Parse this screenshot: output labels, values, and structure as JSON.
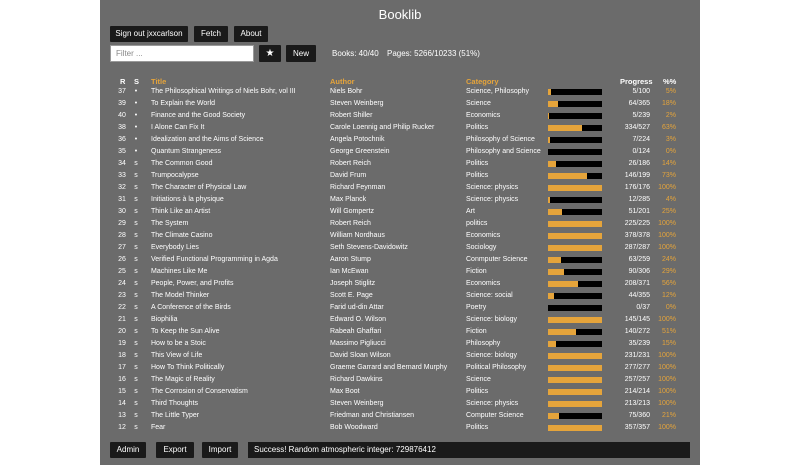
{
  "app": {
    "title": "Booklib",
    "signout_label": "Sign out jxxcarlson",
    "fetch_label": "Fetch",
    "about_label": "About",
    "filter_placeholder": "Filter ...",
    "star_label": "★",
    "new_label": "New",
    "books_stat": "Books: 40/40",
    "pages_stat": "Pages: 5266/10233 (51%)"
  },
  "table": {
    "headers": {
      "r": "R",
      "s": "S",
      "title": "Title",
      "author": "Author",
      "category": "Category",
      "progress": "Progress",
      "pct": "%%"
    },
    "rows": [
      {
        "r": "37",
        "s": "•",
        "title": "The Philosophical Writings of Niels Bohr, vol III",
        "author": "Niels Bohr",
        "category": "Science, Philosophy",
        "progress": "5/100",
        "pct": "5%",
        "fraction": 0.05
      },
      {
        "r": "39",
        "s": "•",
        "title": "To Explain the World",
        "author": "Steven Weinberg",
        "category": "Science",
        "progress": "64/365",
        "pct": "18%",
        "fraction": 0.18
      },
      {
        "r": "40",
        "s": "•",
        "title": "Finance and the Good Society",
        "author": "Robert Shiller",
        "category": "Economics",
        "progress": "5/239",
        "pct": "2%",
        "fraction": 0.02
      },
      {
        "r": "38",
        "s": "•",
        "title": "I Alone Can Fix It",
        "author": "Carole Loennig and Philip Rucker",
        "category": "Politics",
        "progress": "334/527",
        "pct": "63%",
        "fraction": 0.63
      },
      {
        "r": "36",
        "s": "•",
        "title": "Idealization and the Aims of Science",
        "author": "Angela Potochnik",
        "category": "Philosophy of Science",
        "progress": "7/224",
        "pct": "3%",
        "fraction": 0.03
      },
      {
        "r": "35",
        "s": "•",
        "title": "Quantum Strangeness",
        "author": "George Greenstein",
        "category": "Philosophy and Science",
        "progress": "0/124",
        "pct": "0%",
        "fraction": 0
      },
      {
        "r": "34",
        "s": "s",
        "title": "The Common Good",
        "author": "Robert Reich",
        "category": "Politics",
        "progress": "26/186",
        "pct": "14%",
        "fraction": 0.14
      },
      {
        "r": "33",
        "s": "s",
        "title": "Trumpocalypse",
        "author": "David Frum",
        "category": "Politics",
        "progress": "146/199",
        "pct": "73%",
        "fraction": 0.73
      },
      {
        "r": "32",
        "s": "s",
        "title": "The Character of Physical Law",
        "author": "Richard Feynman",
        "category": "Science: physics",
        "progress": "176/176",
        "pct": "100%",
        "fraction": 1
      },
      {
        "r": "31",
        "s": "s",
        "title": "Initiations à la physique",
        "author": "Max Planck",
        "category": "Science: physics",
        "progress": "12/285",
        "pct": "4%",
        "fraction": 0.04
      },
      {
        "r": "30",
        "s": "s",
        "title": "Think Like an Artist",
        "author": "Will Gompertz",
        "category": "Art",
        "progress": "51/201",
        "pct": "25%",
        "fraction": 0.25
      },
      {
        "r": "29",
        "s": "s",
        "title": "The System",
        "author": "Robert Reich",
        "category": "politics",
        "progress": "225/225",
        "pct": "100%",
        "fraction": 1
      },
      {
        "r": "28",
        "s": "s",
        "title": "The Climate Casino",
        "author": "William Nordhaus",
        "category": "Economics",
        "progress": "378/378",
        "pct": "100%",
        "fraction": 1
      },
      {
        "r": "27",
        "s": "s",
        "title": "Everybody Lies",
        "author": "Seth Stevens-Davidowitz",
        "category": "Sociology",
        "progress": "287/287",
        "pct": "100%",
        "fraction": 1
      },
      {
        "r": "26",
        "s": "s",
        "title": "Verified Functional Programming in Agda",
        "author": "Aaron Stump",
        "category": "Conmputer Science",
        "progress": "63/259",
        "pct": "24%",
        "fraction": 0.24
      },
      {
        "r": "25",
        "s": "s",
        "title": "Machines Like Me",
        "author": "Ian McEwan",
        "category": "Fiction",
        "progress": "90/306",
        "pct": "29%",
        "fraction": 0.29
      },
      {
        "r": "24",
        "s": "s",
        "title": "People, Power, and Profits",
        "author": "Joseph Stiglitz",
        "category": "Economics",
        "progress": "208/371",
        "pct": "56%",
        "fraction": 0.56
      },
      {
        "r": "23",
        "s": "s",
        "title": "The Model Thinker",
        "author": "Scott E. Page",
        "category": "Science: social",
        "progress": "44/355",
        "pct": "12%",
        "fraction": 0.12
      },
      {
        "r": "22",
        "s": "s",
        "title": "A Conference of the Birds",
        "author": "Farid ud-din Attar",
        "category": "Poetry",
        "progress": "0/37",
        "pct": "0%",
        "fraction": 0
      },
      {
        "r": "21",
        "s": "s",
        "title": "Biophilia",
        "author": "Edward O. Wilson",
        "category": "Science: biology",
        "progress": "145/145",
        "pct": "100%",
        "fraction": 1
      },
      {
        "r": "20",
        "s": "s",
        "title": "To Keep the Sun Alive",
        "author": "Rabeah Ghaffari",
        "category": "Fiction",
        "progress": "140/272",
        "pct": "51%",
        "fraction": 0.51
      },
      {
        "r": "19",
        "s": "s",
        "title": "How to be a Stoic",
        "author": "Massimo Pigliucci",
        "category": "Philosophy",
        "progress": "35/239",
        "pct": "15%",
        "fraction": 0.15
      },
      {
        "r": "18",
        "s": "s",
        "title": "This View of Life",
        "author": "David Sloan Wilson",
        "category": "Science: biology",
        "progress": "231/231",
        "pct": "100%",
        "fraction": 1
      },
      {
        "r": "17",
        "s": "s",
        "title": "How To Think Politically",
        "author": "Graeme Garrard and Bernard Murphy",
        "category": "Political Philosophy",
        "progress": "277/277",
        "pct": "100%",
        "fraction": 1
      },
      {
        "r": "16",
        "s": "s",
        "title": "The Magic of Reality",
        "author": "Richard Dawkins",
        "category": "Science",
        "progress": "257/257",
        "pct": "100%",
        "fraction": 1
      },
      {
        "r": "15",
        "s": "s",
        "title": "The Corrosion of Conservatism",
        "author": "Max Boot",
        "category": "Politics",
        "progress": "214/214",
        "pct": "100%",
        "fraction": 1
      },
      {
        "r": "14",
        "s": "s",
        "title": "Third Thoughts",
        "author": "Steven Weinberg",
        "category": "Science: physics",
        "progress": "213/213",
        "pct": "100%",
        "fraction": 1
      },
      {
        "r": "13",
        "s": "s",
        "title": "The Little Typer",
        "author": "Friedman and Christiansen",
        "category": "Computer Science",
        "progress": "75/360",
        "pct": "21%",
        "fraction": 0.21
      },
      {
        "r": "12",
        "s": "s",
        "title": "Fear",
        "author": "Bob Woodward",
        "category": "Politics",
        "progress": "357/357",
        "pct": "100%",
        "fraction": 1
      }
    ]
  },
  "footer": {
    "admin_label": "Admin",
    "export_label": "Export",
    "import_label": "Import",
    "message": "Success! Random atmospheric integer: 729876412"
  },
  "colors": {
    "accent": "#e5a43b",
    "panel": "#6b6b6b",
    "button": "#1a1a1a"
  }
}
